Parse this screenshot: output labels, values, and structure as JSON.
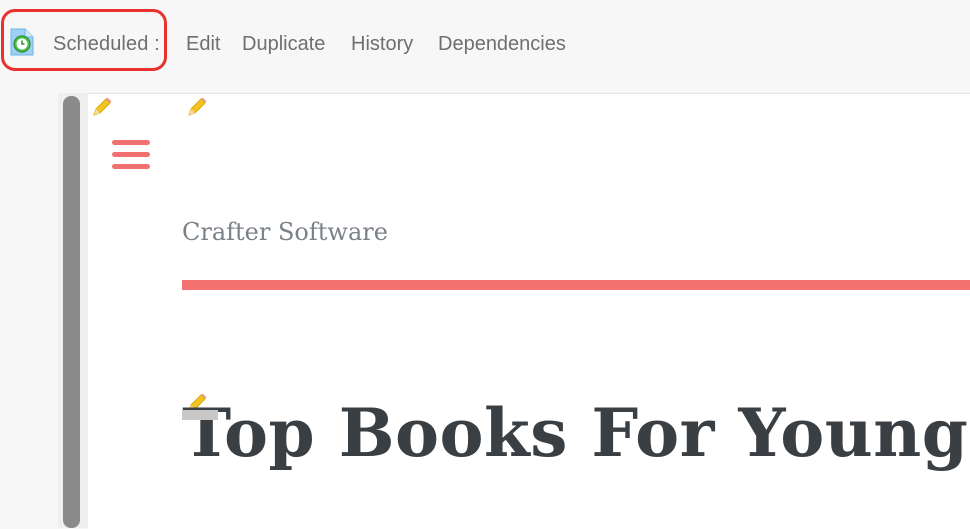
{
  "toolbar": {
    "status_label": "Scheduled :",
    "items": [
      {
        "id": "edit",
        "label": "Edit"
      },
      {
        "id": "duplicate",
        "label": "Duplicate"
      },
      {
        "id": "history",
        "label": "History"
      },
      {
        "id": "dependencies",
        "label": "Dependencies"
      }
    ],
    "status_icon": "scheduled-clock-file-icon",
    "highlight_color": "#e8322e"
  },
  "preview": {
    "site_title": "Crafter Software",
    "hero_title": "Top Books For Young",
    "accent_color": "#f47171",
    "edit_icon": "pencil-icon",
    "menu_icon": "hamburger-icon"
  }
}
